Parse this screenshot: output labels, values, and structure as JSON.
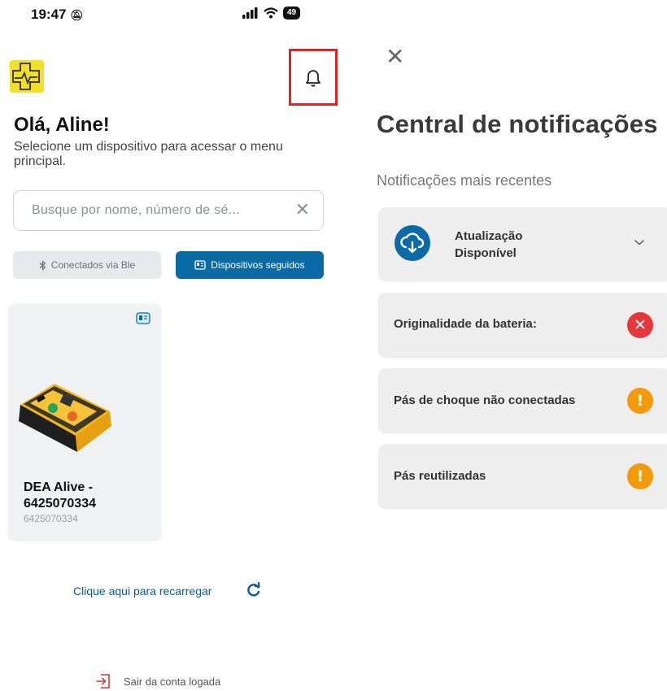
{
  "status_bar": {
    "time": "19:47",
    "battery": "49"
  },
  "left": {
    "greeting": "Olá, Aline!",
    "subtitle": "Selecione um dispositivo para acessar o menu principal.",
    "search": {
      "placeholder": "Busque por nome, número de sé..."
    },
    "filters": {
      "ble_label": "Conectados via Ble",
      "followed_label": "Dispositivos seguidos"
    },
    "device": {
      "title": "DEA Alive - 6425070334",
      "serial": "6425070334"
    },
    "reload_label": "Clique aqui para recarregar",
    "logout_label": "Sair da conta logada"
  },
  "right": {
    "title": "Central de notificações",
    "subtitle": "Notificações mais recentes",
    "notifications": [
      {
        "label": "Atualização\nDisponível",
        "icon": "cloud-download-icon",
        "status": "expand"
      },
      {
        "label": "Originalidade da bateria:",
        "icon": "error-icon",
        "status": "error"
      },
      {
        "label": "Pás de choque não conectadas",
        "icon": "warning-icon",
        "status": "warning"
      },
      {
        "label": "Pás reutilizadas",
        "icon": "warning-icon",
        "status": "warning"
      }
    ]
  },
  "colors": {
    "accent_blue": "#0a6aa6",
    "logo_yellow": "#f3df28",
    "highlight_red": "#e02424",
    "error_red": "#e5373c",
    "warning_orange": "#f39a0b"
  }
}
